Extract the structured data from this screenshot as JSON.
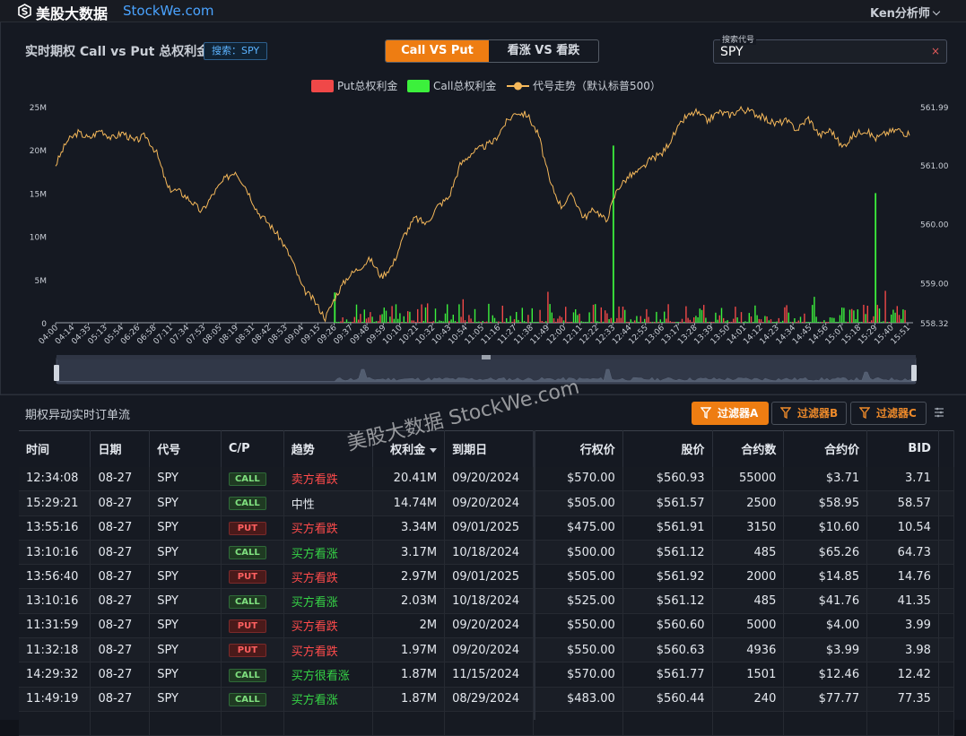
{
  "app": {
    "brand_cn": "美股大数据",
    "brand_en": "StockWe.com",
    "user": "Ken分析师"
  },
  "chart_panel": {
    "title": "实时期权 Call vs Put 总权利金",
    "search_tag": "搜索：SPY",
    "toggle": [
      {
        "label": "Call VS Put",
        "active": true
      },
      {
        "label": "看涨 VS 看跌",
        "active": false
      }
    ],
    "search": {
      "label": "搜索代号",
      "value": "SPY",
      "clear": "×"
    },
    "legend": [
      {
        "label": "Put总权利金",
        "color": "#f04848"
      },
      {
        "label": "Call总权利金",
        "color": "#3cf03c"
      },
      {
        "label": "代号走势（默认标普500）",
        "color": "#f5b85a"
      }
    ]
  },
  "chart_data": {
    "type": "bar",
    "y_left_ticks": [
      "25M",
      "20M",
      "15M",
      "10M",
      "5M",
      "0"
    ],
    "y_left_range": [
      0,
      25000000
    ],
    "y_right_ticks": [
      "561.99",
      "561.00",
      "560.00",
      "559.00",
      "558.32"
    ],
    "y_right_range": [
      558.32,
      561.99
    ],
    "x_ticks": [
      "04:00",
      "04:14",
      "04:35",
      "05:13",
      "05:54",
      "06:26",
      "06:58",
      "07:11",
      "07:34",
      "07:53",
      "08:05",
      "08:19",
      "08:31",
      "08:42",
      "08:53",
      "09:04",
      "09:15",
      "09:26",
      "09:37",
      "09:48",
      "09:59",
      "10:10",
      "10:21",
      "10:32",
      "10:43",
      "10:54",
      "11:05",
      "11:16",
      "11:27",
      "11:38",
      "11:49",
      "12:00",
      "12:11",
      "12:22",
      "12:33",
      "12:44",
      "12:55",
      "13:06",
      "13:17",
      "13:28",
      "13:39",
      "13:50",
      "14:01",
      "14:12",
      "14:23",
      "14:34",
      "14:45",
      "14:56",
      "15:07",
      "15:18",
      "15:29",
      "15:40",
      "15:51"
    ],
    "series": [
      {
        "name": "代号走势（默认标普500）",
        "type": "line",
        "values": [
          561.0,
          561.4,
          561.55,
          561.45,
          561.6,
          561.45,
          561.55,
          561.4,
          561.5,
          561.2,
          560.6,
          560.55,
          560.4,
          560.2,
          560.5,
          560.75,
          560.9,
          560.6,
          560.2,
          560.0,
          559.75,
          559.4,
          558.9,
          558.7,
          558.4,
          558.8,
          559.1,
          559.25,
          559.4,
          559.1,
          559.3,
          559.8,
          560.1,
          560.0,
          560.3,
          560.45,
          561.0,
          561.2,
          561.3,
          561.4,
          561.7,
          561.9,
          561.85,
          561.5,
          560.7,
          560.3,
          560.5,
          560.1,
          560.25,
          560.05,
          560.6,
          560.8,
          560.9,
          561.1,
          561.2,
          561.5,
          561.8,
          561.9,
          561.75,
          561.9,
          561.85,
          561.95,
          561.9,
          561.8,
          561.7,
          561.75,
          561.6,
          561.8,
          561.5,
          561.6,
          561.3,
          561.5,
          561.6,
          561.45,
          561.55,
          561.6,
          561.5
        ]
      },
      {
        "name": "Call总权利金",
        "type": "bar",
        "peaks": [
          {
            "time": "12:33",
            "value": 20500000
          },
          {
            "time": "15:29",
            "value": 15000000
          },
          {
            "time": "09:26",
            "value": 3500000
          }
        ],
        "values": []
      },
      {
        "name": "Put总权利金",
        "type": "bar",
        "values": []
      }
    ]
  },
  "flow_panel": {
    "title": "期权异动实时订单流",
    "filters": [
      {
        "label": "过滤器A",
        "active": true
      },
      {
        "label": "过滤器B",
        "active": false
      },
      {
        "label": "过滤器C",
        "active": false
      }
    ],
    "watermark": "美股大数据 StockWe.com",
    "columns": [
      "时间",
      "日期",
      "代号",
      "C/P",
      "趋势",
      "权利金",
      "到期日",
      "行权价",
      "股价",
      "合约数",
      "合约价",
      "BID"
    ],
    "rows": [
      [
        "12:34:08",
        "08-27",
        "SPY",
        "CALL",
        "卖方看跌",
        "20.41M",
        "09/20/2024",
        "$570.00",
        "$560.93",
        "55000",
        "$3.71",
        "3.71"
      ],
      [
        "15:29:21",
        "08-27",
        "SPY",
        "CALL",
        "中性",
        "14.74M",
        "09/20/2024",
        "$505.00",
        "$561.57",
        "2500",
        "$58.95",
        "58.57"
      ],
      [
        "13:55:16",
        "08-27",
        "SPY",
        "PUT",
        "买方看跌",
        "3.34M",
        "09/01/2025",
        "$475.00",
        "$561.91",
        "3150",
        "$10.60",
        "10.54"
      ],
      [
        "13:10:16",
        "08-27",
        "SPY",
        "CALL",
        "买方看涨",
        "3.17M",
        "10/18/2024",
        "$500.00",
        "$561.12",
        "485",
        "$65.26",
        "64.73"
      ],
      [
        "13:56:40",
        "08-27",
        "SPY",
        "PUT",
        "买方看跌",
        "2.97M",
        "09/01/2025",
        "$505.00",
        "$561.92",
        "2000",
        "$14.85",
        "14.76"
      ],
      [
        "13:10:16",
        "08-27",
        "SPY",
        "CALL",
        "买方看涨",
        "2.03M",
        "10/18/2024",
        "$525.00",
        "$561.12",
        "485",
        "$41.76",
        "41.35"
      ],
      [
        "11:31:59",
        "08-27",
        "SPY",
        "PUT",
        "买方看跌",
        "2M",
        "09/20/2024",
        "$550.00",
        "$560.60",
        "5000",
        "$4.00",
        "3.99"
      ],
      [
        "11:32:18",
        "08-27",
        "SPY",
        "PUT",
        "买方看跌",
        "1.97M",
        "09/20/2024",
        "$550.00",
        "$560.63",
        "4936",
        "$3.99",
        "3.98"
      ],
      [
        "14:29:32",
        "08-27",
        "SPY",
        "CALL",
        "买方很看涨",
        "1.87M",
        "11/15/2024",
        "$570.00",
        "$561.77",
        "1501",
        "$12.46",
        "12.42"
      ],
      [
        "11:49:19",
        "08-27",
        "SPY",
        "CALL",
        "买方看涨",
        "1.87M",
        "08/29/2024",
        "$483.00",
        "$560.44",
        "240",
        "$77.77",
        "77.35"
      ]
    ]
  }
}
